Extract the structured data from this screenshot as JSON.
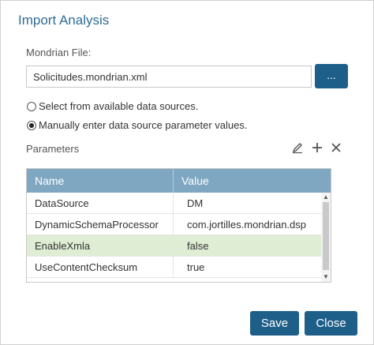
{
  "dialog": {
    "title": "Import Analysis",
    "file_label": "Mondrian File:",
    "file_value": "Solicitudes.mondrian.xml",
    "browse_label": "...",
    "radio_options": [
      {
        "label": "Select from available data sources.",
        "checked": false
      },
      {
        "label": "Manually enter data source parameter values.",
        "checked": true
      }
    ],
    "parameters_label": "Parameters",
    "toolbar_icons": [
      "edit-icon",
      "add-icon",
      "delete-icon"
    ],
    "grid": {
      "columns": [
        "Name",
        "Value"
      ],
      "rows": [
        {
          "name": "DataSource",
          "value": "DM",
          "selected": false
        },
        {
          "name": "DynamicSchemaProcessor",
          "value": "com.jortilles.mondrian.dsp",
          "selected": false
        },
        {
          "name": "EnableXmla",
          "value": "false",
          "selected": true
        },
        {
          "name": "UseContentChecksum",
          "value": "true",
          "selected": false
        }
      ]
    },
    "save_label": "Save",
    "close_label": "Close"
  },
  "colors": {
    "accent": "#1e5f8a",
    "title": "#2e6d96",
    "grid_header": "#7fa7c1",
    "selected_row": "#dfedd5"
  }
}
